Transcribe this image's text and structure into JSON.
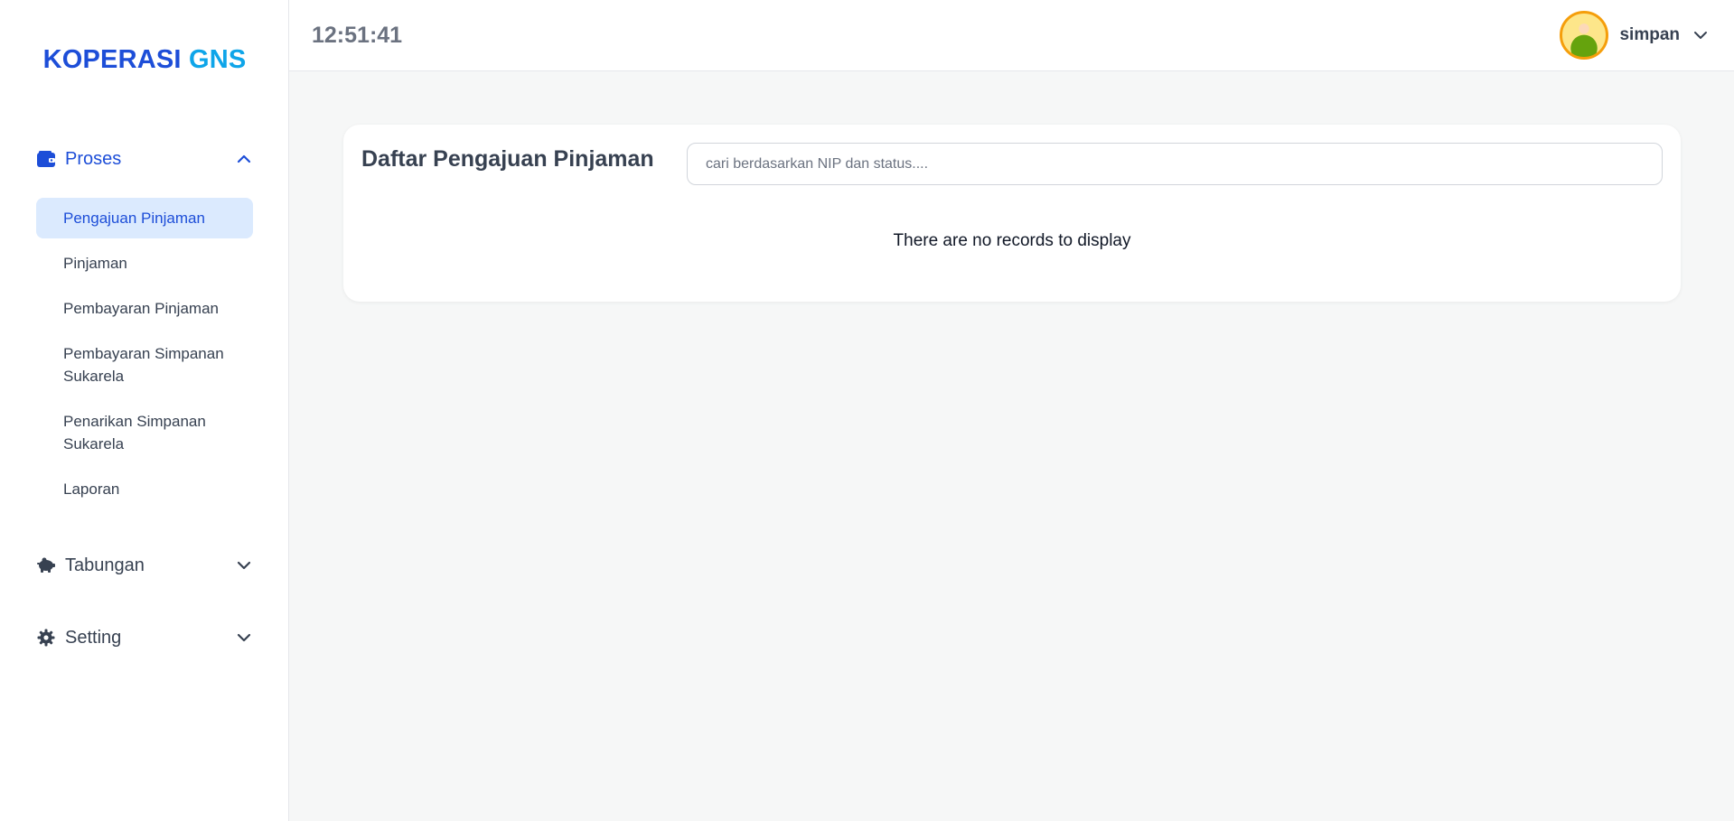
{
  "brand": {
    "part1": "KOPERASI",
    "part2": "GNS"
  },
  "sidebar": {
    "groups": [
      {
        "label": "Proses",
        "icon": "wallet-icon",
        "expanded": true
      },
      {
        "label": "Tabungan",
        "icon": "piggy-bank-icon",
        "expanded": false
      },
      {
        "label": "Setting",
        "icon": "gear-icon",
        "expanded": false
      }
    ],
    "proses_items": [
      {
        "label": "Pengajuan Pinjaman",
        "active": true
      },
      {
        "label": "Pinjaman"
      },
      {
        "label": "Pembayaran Pinjaman"
      },
      {
        "label": "Pembayaran Simpanan Sukarela"
      },
      {
        "label": "Penarikan Simpanan Sukarela"
      },
      {
        "label": "Laporan"
      }
    ]
  },
  "header": {
    "clock": "12:51:41",
    "username": "simpan"
  },
  "main": {
    "title": "Daftar Pengajuan Pinjaman",
    "search_placeholder": "cari berdasarkan NIP dan status....",
    "empty_message": "There are no records to display"
  },
  "colors": {
    "accent": "#1d4ed8",
    "brand_secondary": "#0ea5e9",
    "active_bg": "#dbeafe"
  }
}
